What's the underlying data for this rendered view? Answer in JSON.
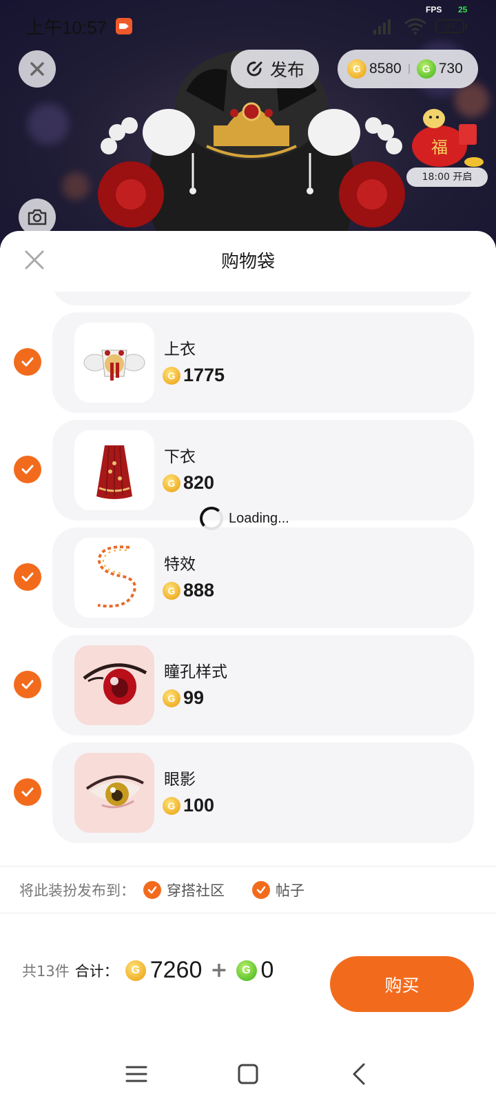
{
  "status_bar": {
    "time": "上午10:57",
    "fps_label": "FPS",
    "fps_value": "25",
    "battery": "84"
  },
  "header": {
    "publish_label": "发布",
    "gold_balance": "8580",
    "green_balance": "730",
    "event_time": "18:00 开启",
    "event_character": "福"
  },
  "sheet": {
    "title": "购物袋",
    "items": [
      {
        "name": "上衣",
        "price": "1775",
        "checked": true,
        "thumb": "top-clothing"
      },
      {
        "name": "下衣",
        "price": "820",
        "checked": true,
        "thumb": "skirt"
      },
      {
        "name": "特效",
        "price": "888",
        "checked": true,
        "thumb": "effect-trail"
      },
      {
        "name": "瞳孔样式",
        "price": "99",
        "checked": true,
        "thumb": "pupil-red"
      },
      {
        "name": "眼影",
        "price": "100",
        "checked": true,
        "thumb": "eye-shadow"
      }
    ],
    "loading_text": "Loading...",
    "publish_to_label": "将此装扮发布到：",
    "publish_options": [
      "穿搭社区",
      "帖子"
    ],
    "count_text": "共13件",
    "total_label": "合计：",
    "total_gold": "7260",
    "plus": "+",
    "total_green": "0",
    "buy_label": "购买"
  },
  "colors": {
    "accent": "#f26b1d",
    "gold_coin": "#f0b12a",
    "green_coin": "#61c42f",
    "card_bg": "#f5f5f8"
  },
  "icons": {
    "close": "close-icon",
    "camera": "camera-icon",
    "publish": "publish-icon",
    "check": "check-icon",
    "nav_menu": "menu-icon",
    "nav_home": "home-icon",
    "nav_back": "back-icon"
  }
}
